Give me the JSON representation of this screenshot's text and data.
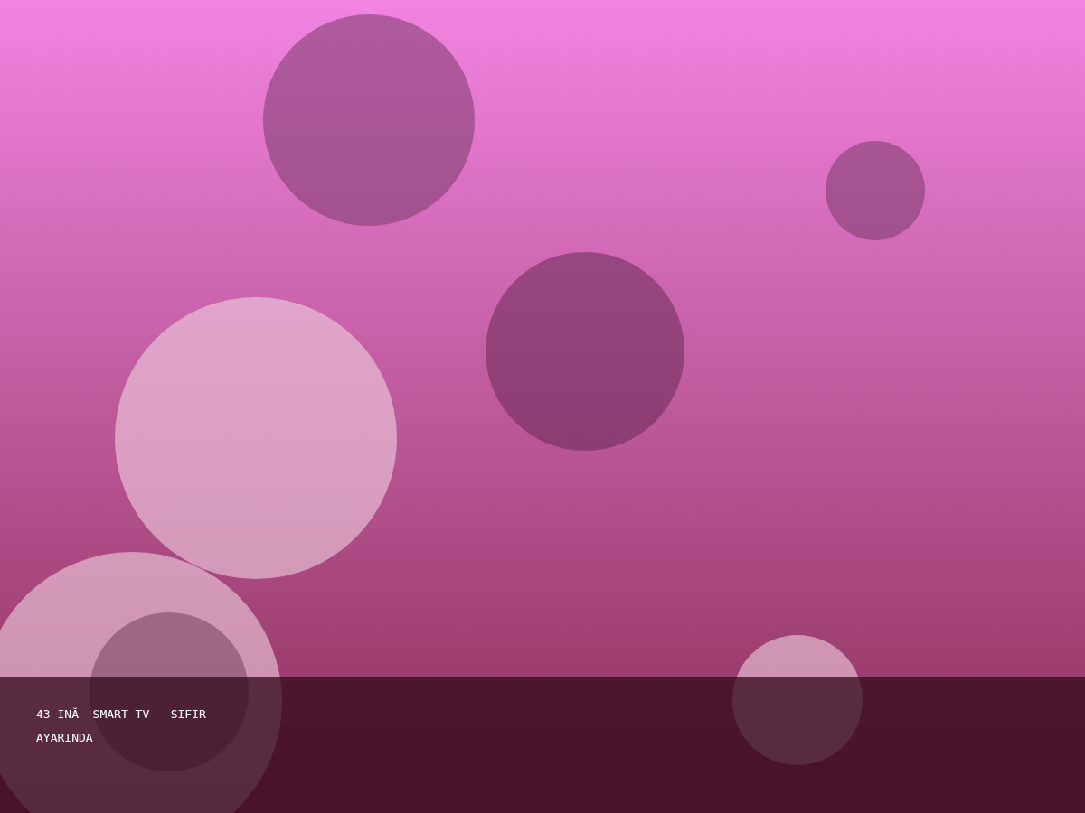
{
  "caption": "43 INĂ  SMART TV – SIFIR AYARINDA"
}
